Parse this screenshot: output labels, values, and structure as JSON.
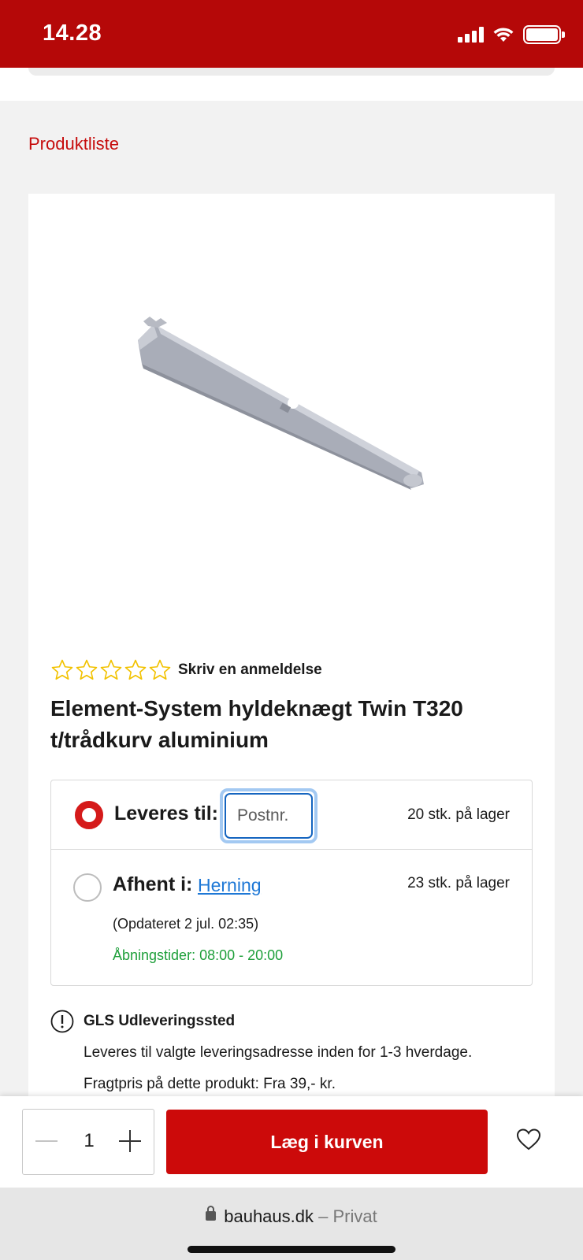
{
  "status_bar": {
    "time": "14.28",
    "icons": [
      "signal-icon",
      "wifi-icon",
      "battery-icon"
    ]
  },
  "breadcrumb": "Produktliste",
  "product": {
    "image_icon": "shelf-bracket-image",
    "review_link": "Skriv en anmeldelse",
    "rating_stars_filled": 0,
    "rating_stars_total": 5,
    "title": "Element-System hyldeknægt Twin T320 t/trådkurv aluminium"
  },
  "delivery": {
    "deliver_label": "Leveres til:",
    "postcode_placeholder": "Postnr.",
    "deliver_stock": "20 stk. på lager",
    "deliver_selected": true,
    "pickup_label": "Afhent i:",
    "pickup_store": "Herning",
    "pickup_stock": "23 stk. på lager",
    "updated": "(Opdateret 2 jul. 02:35)",
    "hours": "Åbningstider: 08:00 - 20:00"
  },
  "shipping_info": {
    "title": "GLS Udleveringssted",
    "line1": "Leveres til valgte leveringsadresse inden for 1-3 hverdage.",
    "line2": "Fragtpris på dette produkt: Fra 39,- kr."
  },
  "cart_bar": {
    "quantity": "1",
    "add_to_cart_label": "Læg i kurven"
  },
  "browser": {
    "domain": "bauhaus.dk",
    "separator": "–",
    "mode": "Privat"
  },
  "colors": {
    "brand_red": "#b50808",
    "button_red": "#cc0a0a",
    "link_blue": "#1e78d6",
    "hours_green": "#1e9f3a",
    "star_yellow": "#f2c200"
  }
}
